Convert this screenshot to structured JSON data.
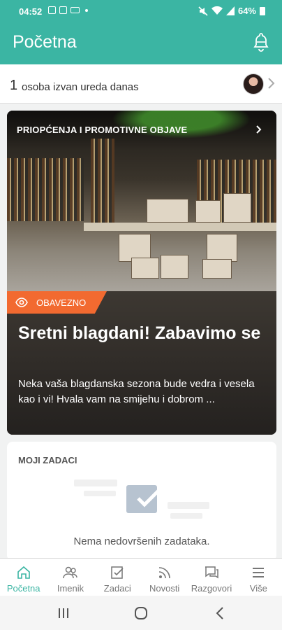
{
  "status_bar": {
    "time": "04:52",
    "battery": "64%"
  },
  "header": {
    "title": "Početna"
  },
  "presence": {
    "count": "1",
    "text": "osoba izvan ureda danas"
  },
  "announcement": {
    "section_label": "PRIOPĆENJA I PROMOTIVNE OBJAVE",
    "badge": "OBAVEZNO",
    "title": "Sretni blagdani! Zabavimo se",
    "description": "Neka vaša blagdanska sezona bude vedra i vesela kao i vi! Hvala vam na smijehu i dobrom ..."
  },
  "tasks": {
    "heading": "MOJI ZADACI",
    "empty_text": "Nema nedovršenih zadataka."
  },
  "bottom_nav": {
    "items": [
      {
        "label": "Početna",
        "icon": "home-icon",
        "active": true
      },
      {
        "label": "Imenik",
        "icon": "people-icon",
        "active": false
      },
      {
        "label": "Zadaci",
        "icon": "tasks-icon",
        "active": false
      },
      {
        "label": "Novosti",
        "icon": "rss-icon",
        "active": false
      },
      {
        "label": "Razgovori",
        "icon": "chat-icon",
        "active": false
      },
      {
        "label": "Više",
        "icon": "menu-icon",
        "active": false
      }
    ]
  },
  "colors": {
    "header": "#3bb5a3",
    "accent": "#f26a30",
    "active_nav": "#3bb5a3"
  }
}
